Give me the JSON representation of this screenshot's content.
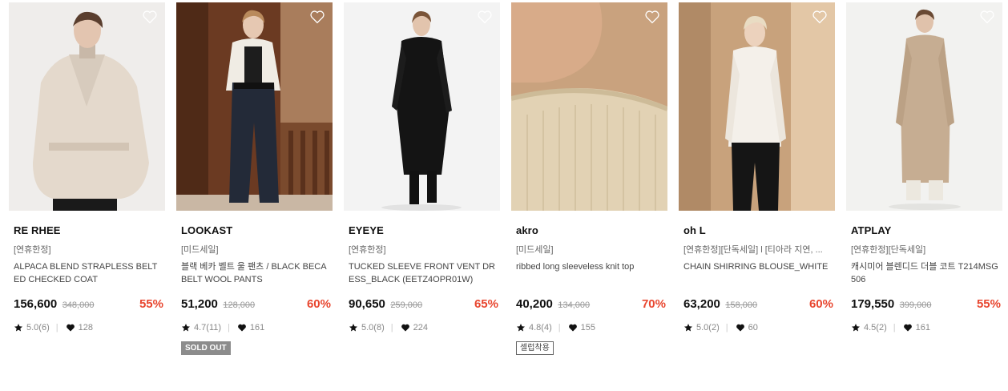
{
  "colors": {
    "discount": "#e8462f",
    "sold_badge_bg": "#8c8c8c"
  },
  "icons": {
    "wishlist": "heart-outline-icon",
    "rating": "star-icon",
    "likes": "heart-filled-icon"
  },
  "products": [
    {
      "brand": "RE RHEE",
      "tag": "[연휴한정]",
      "name": "ALPACA BLEND STRAPLESS BELTED CHECKED COAT",
      "price": "156,600",
      "original_price": "348,000",
      "discount": "55%",
      "rating": "5.0(6)",
      "likes": "128",
      "badge": ""
    },
    {
      "brand": "LOOKAST",
      "tag": "[미드세일]",
      "name": "블랙 베카 벨트 울 팬츠 / BLACK BECA BELT WOOL PANTS",
      "price": "51,200",
      "original_price": "128,000",
      "discount": "60%",
      "rating": "4.7(11)",
      "likes": "161",
      "badge": "SOLD OUT"
    },
    {
      "brand": "EYEYE",
      "tag": "[연휴한정]",
      "name": "TUCKED SLEEVE FRONT VENT DRESS_BLACK (EETZ4OPR01W)",
      "price": "90,650",
      "original_price": "259,000",
      "discount": "65%",
      "rating": "5.0(8)",
      "likes": "224",
      "badge": ""
    },
    {
      "brand": "akro",
      "tag": "[미드세일]",
      "name": "ribbed long sleeveless knit top",
      "price": "40,200",
      "original_price": "134,000",
      "discount": "70%",
      "rating": "4.8(4)",
      "likes": "155",
      "badge": "셀럽착용"
    },
    {
      "brand": "oh L",
      "tag": "[연휴한정][단독세일] l [티아라 지연, ...",
      "name": "CHAIN SHIRRING BLOUSE_WHITE",
      "price": "63,200",
      "original_price": "158,000",
      "discount": "60%",
      "rating": "5.0(2)",
      "likes": "60",
      "badge": ""
    },
    {
      "brand": "ATPLAY",
      "tag": "[연휴한정][단독세일]",
      "name": "캐시미어 블렌디드 더블 코트 T214MSG506",
      "price": "179,550",
      "original_price": "399,000",
      "discount": "55%",
      "rating": "4.5(2)",
      "likes": "161",
      "badge": ""
    }
  ]
}
